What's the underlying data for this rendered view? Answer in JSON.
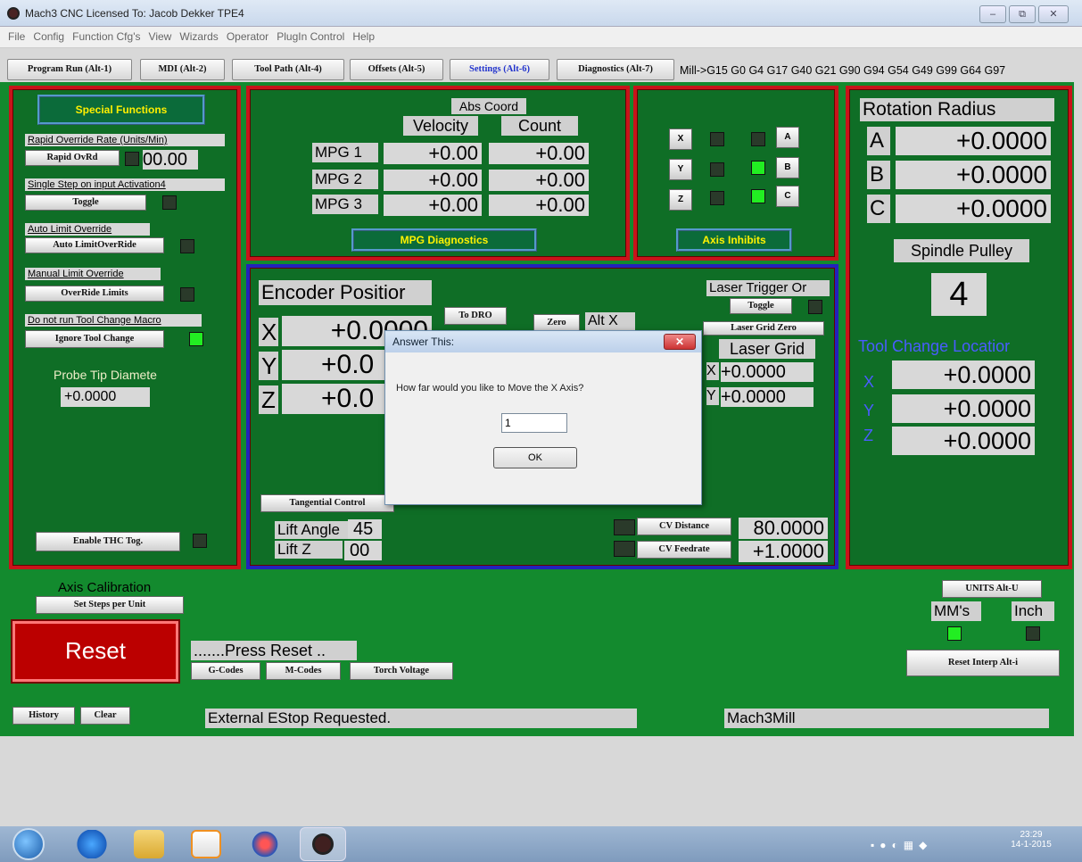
{
  "window": {
    "title": "Mach3 CNC  Licensed To: Jacob Dekker TPE4",
    "min": "–",
    "max": "⧉",
    "close": "✕"
  },
  "menu": [
    "File",
    "Config",
    "Function Cfg's",
    "View",
    "Wizards",
    "Operator",
    "PlugIn Control",
    "Help"
  ],
  "tabs": [
    "Program Run (Alt-1)",
    "MDI (Alt-2)",
    "Tool Path (Alt-4)",
    "Offsets (Alt-5)",
    "Settings (Alt-6)",
    "Diagnostics (Alt-7)"
  ],
  "gcode_status": "Mill->G15  G0 G4 G17 G40 G21 G90 G94 G54 G49 G99 G64 G97",
  "special": {
    "header": "Special Functions",
    "rapid_label": "Rapid Override Rate (Units/Min)",
    "rapid_btn": "Rapid OvRd",
    "rapid_val": "00.00",
    "single_label": "Single Step on input Activation4",
    "toggle": "Toggle",
    "auto_label": "Auto Limit Override",
    "auto_btn": "Auto LimitOverRide",
    "manual_label": "Manual Limit Override",
    "manual_btn": "OverRide Limits",
    "tool_label": "Do not run Tool Change Macro",
    "tool_btn": "Ignore Tool Change",
    "probe_label": "Probe Tip Diamete",
    "probe_val": "+0.0000",
    "thc": "Enable THC Tog."
  },
  "mpg": {
    "abs": "Abs Coord",
    "velocity": "Velocity",
    "count": "Count",
    "rows": [
      {
        "name": "MPG 1",
        "vel": "+0.00",
        "cnt": "+0.00"
      },
      {
        "name": "MPG 2",
        "vel": "+0.00",
        "cnt": "+0.00"
      },
      {
        "name": "MPG 3",
        "vel": "+0.00",
        "cnt": "+0.00"
      }
    ],
    "diag": "MPG Diagnostics"
  },
  "inhibit": {
    "x": "X",
    "y": "Y",
    "z": "Z",
    "a": "A",
    "b": "B",
    "c": "C",
    "label": "Axis Inhibits"
  },
  "rotation": {
    "title": "Rotation Radius",
    "rows": [
      {
        "axis": "A",
        "val": "+0.0000"
      },
      {
        "axis": "B",
        "val": "+0.0000"
      },
      {
        "axis": "C",
        "val": "+0.0000"
      }
    ],
    "pulley_label": "Spindle Pulley",
    "pulley_val": "4",
    "tool_change": "Tool Change Locatior",
    "tc": [
      {
        "axis": "X",
        "val": "+0.0000"
      },
      {
        "axis": "Y",
        "val": "+0.0000"
      },
      {
        "axis": "Z",
        "val": "+0.0000"
      }
    ]
  },
  "encoder": {
    "title": "Encoder Positior",
    "rows": [
      {
        "axis": "X",
        "val": "+0.0000"
      },
      {
        "axis": "Y",
        "val": "+0.0"
      },
      {
        "axis": "Z",
        "val": "+0.0"
      }
    ],
    "to_dro": "To DRO",
    "zero": "Zero",
    "alt_x": "Alt X",
    "laser_trig": "Laser Trigger Or",
    "toggle": "Toggle",
    "laser_zero": "Laser Grid Zero",
    "laser_grid": "Laser Grid",
    "lg": [
      {
        "axis": "X",
        "val": "+0.0000"
      },
      {
        "axis": "Y",
        "val": "+0.0000"
      }
    ],
    "tangential": "Tangential Control",
    "lift_angle": "Lift Angle",
    "lift_angle_val": "45",
    "lift_z": "Lift Z",
    "lift_z_val": "00",
    "cv_dist": "CV Distance",
    "cv_dist_val": "80.0000",
    "cv_feed": "CV Feedrate",
    "cv_feed_val": "+1.0000"
  },
  "dialog": {
    "title": "Answer This:",
    "prompt": "How far would you like to Move the X Axis?",
    "value": "1",
    "ok": "OK",
    "close": "✕"
  },
  "bottom": {
    "axis_cal": "Axis Calibration",
    "set_steps": "Set Steps per Unit",
    "reset": "Reset",
    "press_reset": ".......Press Reset ..",
    "gcodes": "G-Codes",
    "mcodes": "M-Codes",
    "torch": "Torch Voltage",
    "units_btn": "UNITS Alt-U",
    "mm": "MM's",
    "inch": "Inch",
    "reset_interp": "Reset Interp Alt-i",
    "history": "History",
    "clear": "Clear",
    "status": "External EStop Requested.",
    "profile": "Mach3Mill"
  },
  "taskbar": {
    "time": "23:29",
    "date": "14-1-2015"
  }
}
